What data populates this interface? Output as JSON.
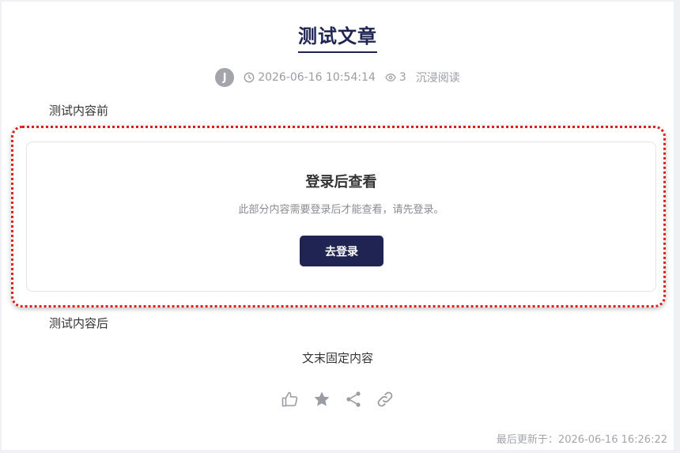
{
  "article": {
    "title": "测试文章",
    "author_initial": "J",
    "datetime": "2026-06-16 10:54:14",
    "views": "3",
    "immersive_label": "沉浸阅读",
    "content_before": "测试内容前",
    "content_after": "测试内容后",
    "footer_text": "文末固定内容",
    "updated_label": "最后更新于：",
    "updated_time": "2026-06-16 16:26:22"
  },
  "login_gate": {
    "title": "登录后查看",
    "description": "此部分内容需要登录后才能查看，请先登录。",
    "button_label": "去登录"
  },
  "actions": {
    "icons": [
      "thumbs-up-icon",
      "star-icon",
      "share-icon",
      "link-icon"
    ]
  },
  "colors": {
    "brand": "#1f2453",
    "frame_highlight": "#e01b1b",
    "muted": "#9a9ca3"
  }
}
